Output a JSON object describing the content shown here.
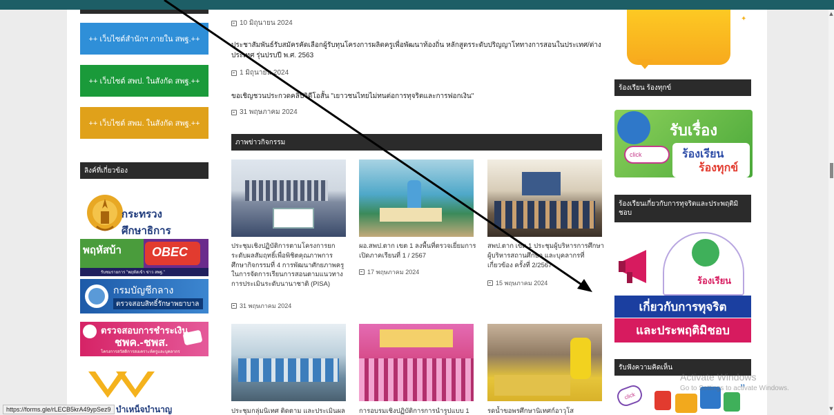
{
  "browser": {
    "status_url": "https://forms.gle/rLECB5krA49ypSez9",
    "activate_title": "Activate Windows",
    "activate_sub": "Go to Settings to activate Windows."
  },
  "left": {
    "buttons": [
      {
        "label": "++ เว็บไซต์สำนักฯ ภายใน สพฐ.++",
        "color": "#2f8fd8"
      },
      {
        "label": "++ เว็บไซต์ สพป. ในสังกัด สพฐ.++",
        "color": "#1a9a3a"
      },
      {
        "label": "++ เว็บไซต์ สพม. ในสังกัด สพฐ.++",
        "color": "#e0a11a"
      }
    ],
    "links_heading": "ลิงค์ที่เกี่ยวข้อง",
    "logos": {
      "moe": "กระทรวงศึกษาธิการ",
      "obec_left": "พฤหัสบ้า",
      "obec_right": "OBEC",
      "obec_sub": "รับชมรายการ \"พฤหัสเข้า ข่าว สพฐ.\"",
      "cgd_title": "กรมบัญชีกลาง",
      "cgd_sub": "ตรวจสอบสิทธิ์รักษาพยาบาล",
      "pay_title": "ตรวจสอบการชำระเงิน",
      "pay_sub": "ชพค.-ชพส.",
      "pay_small": "โครงการสวัสดิการสงเคราะห์ครูและบุคลากร",
      "debt_label": "บำเหน็จบำนาญข้าราชการ"
    }
  },
  "middle": {
    "news": [
      {
        "date": "10 มิถุนายน 2024"
      },
      {
        "title": "ประชาสัมพันธ์รับสมัครคัดเลือกผู้รับทุนโครงการผลิตครูเพื่อพัฒนาท้องถิ่น หลักสูตรระดับปริญญาโททางการสอนในประเทศ/ต่างประเทศ รุ่นปรบปี พ.ศ. 2563",
        "date": "1 มิถุนายน 2024"
      },
      {
        "title": "ขอเชิญชวนประกวดคลิปวิดีโอสั้น \"เยาวชนไทยไม่ทนต่อการทุจริตและการฟอกเงิน\"",
        "date": "31 พฤษภาคม 2024"
      }
    ],
    "gallery_heading": "ภาพข่าวกิจกรรม",
    "gallery": [
      {
        "caption": "ประชุมเชิงปฏิบัติการตามโครงการยกระดับผลสัมฤทธิ์เพื่อพิชิตคุณภาพการศึกษากิจกรรมที่ 4 การพัฒนาศักยภาพครูในการจัดการเรียนการสอนตามแนวทางการประเมินระดับนานาชาติ (PISA)",
        "date": "31 พฤษภาคม 2024"
      },
      {
        "caption": "ผอ.สพป.ตาก เขต 1 ลงพื้นที่ตรวจเยี่ยมการเปิดภาคเรียนที่ 1 / 2567",
        "date": "17 พฤษภาคม 2024"
      },
      {
        "caption": "สพป.ตาก เขต 1 ประชุมผู้บริหารการศึกษาผู้บริหารสถานศึกษา และบุคลากรที่เกี่ยวข้อง ครั้งที่ 2/2567",
        "date": "15 พฤษภาคม 2024"
      },
      {
        "caption": "ประชุมกลุ่มนิเทศ ติดตาม และประเมินผล",
        "date": ""
      },
      {
        "caption": "การอบรมเชิงปฏิบัติการการนำรูปแบบ 1",
        "date": ""
      },
      {
        "caption": "รดน้ำขอพรศึกษานิเทศก์อาวุโส",
        "date": ""
      }
    ]
  },
  "right": {
    "complaint_heading": "ร้องเรียน ร้องทุกข์",
    "complaint_banner": {
      "top": "รับเรื่อง",
      "click": "click",
      "line1": "ร้องเรียน",
      "line2": "ร้องทุกข์"
    },
    "corruption_heading": "ร้องเรียนเกี่ยวกับการทุจริตและประพฤติมิชอบ",
    "corruption_banner": {
      "badge": "ร้องเรียน",
      "line1": "เกี่ยวกับการทุจริต",
      "line2": "และประพฤติมิชอบ"
    },
    "opinion_heading": "รับฟังความคิดเห็น",
    "opinion_click": "click",
    "opinion_quote": "”"
  }
}
